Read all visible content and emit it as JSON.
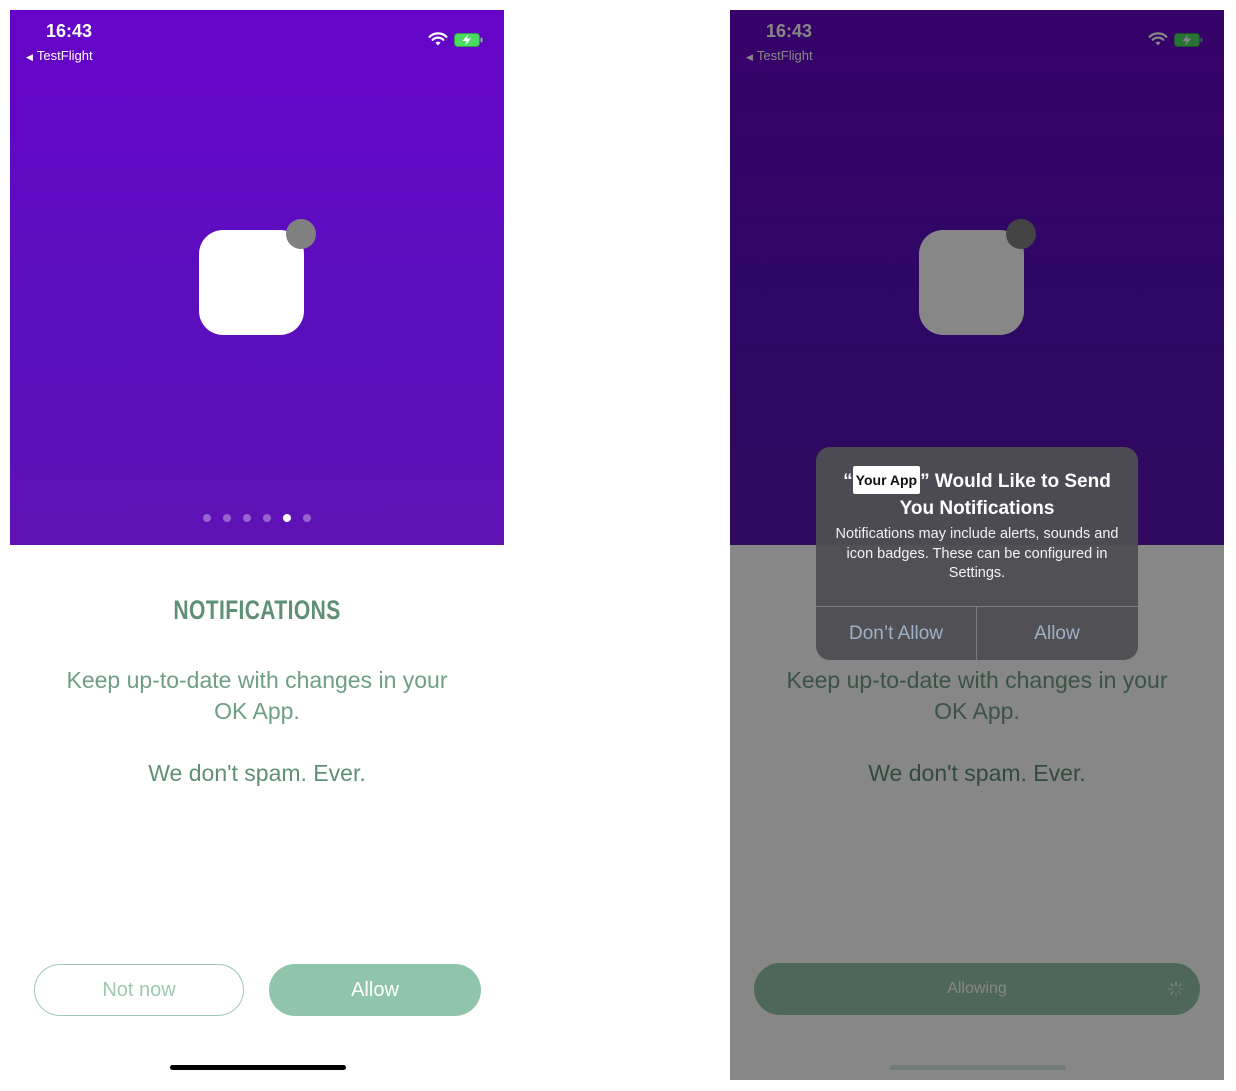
{
  "status_bar": {
    "time": "16:43",
    "back_app": "TestFlight",
    "back_arrow": "◀"
  },
  "onboarding": {
    "title": "NOTIFICATIONS",
    "description_line1": "Keep up-to-date with changes in your",
    "description_line2": "OK App.",
    "no_spam": "We don't spam. Ever.",
    "not_now_label": "Not now",
    "allow_label": "Allow",
    "pager": {
      "total": 6,
      "active_index": 4
    }
  },
  "loading_button_label": "Allowing",
  "system_alert": {
    "quote_open": "“",
    "app_name": "Your App",
    "title_rest": "” Would Like to Send You Notifications",
    "message": "Notifications may include alerts, sounds and icon badges. These can be configured in Settings.",
    "deny_label": "Don’t Allow",
    "allow_label": "Allow"
  },
  "colors": {
    "hero_purple": "#6604c8",
    "accent_green": "#91c5ab",
    "text_green": "#5f8f76"
  }
}
